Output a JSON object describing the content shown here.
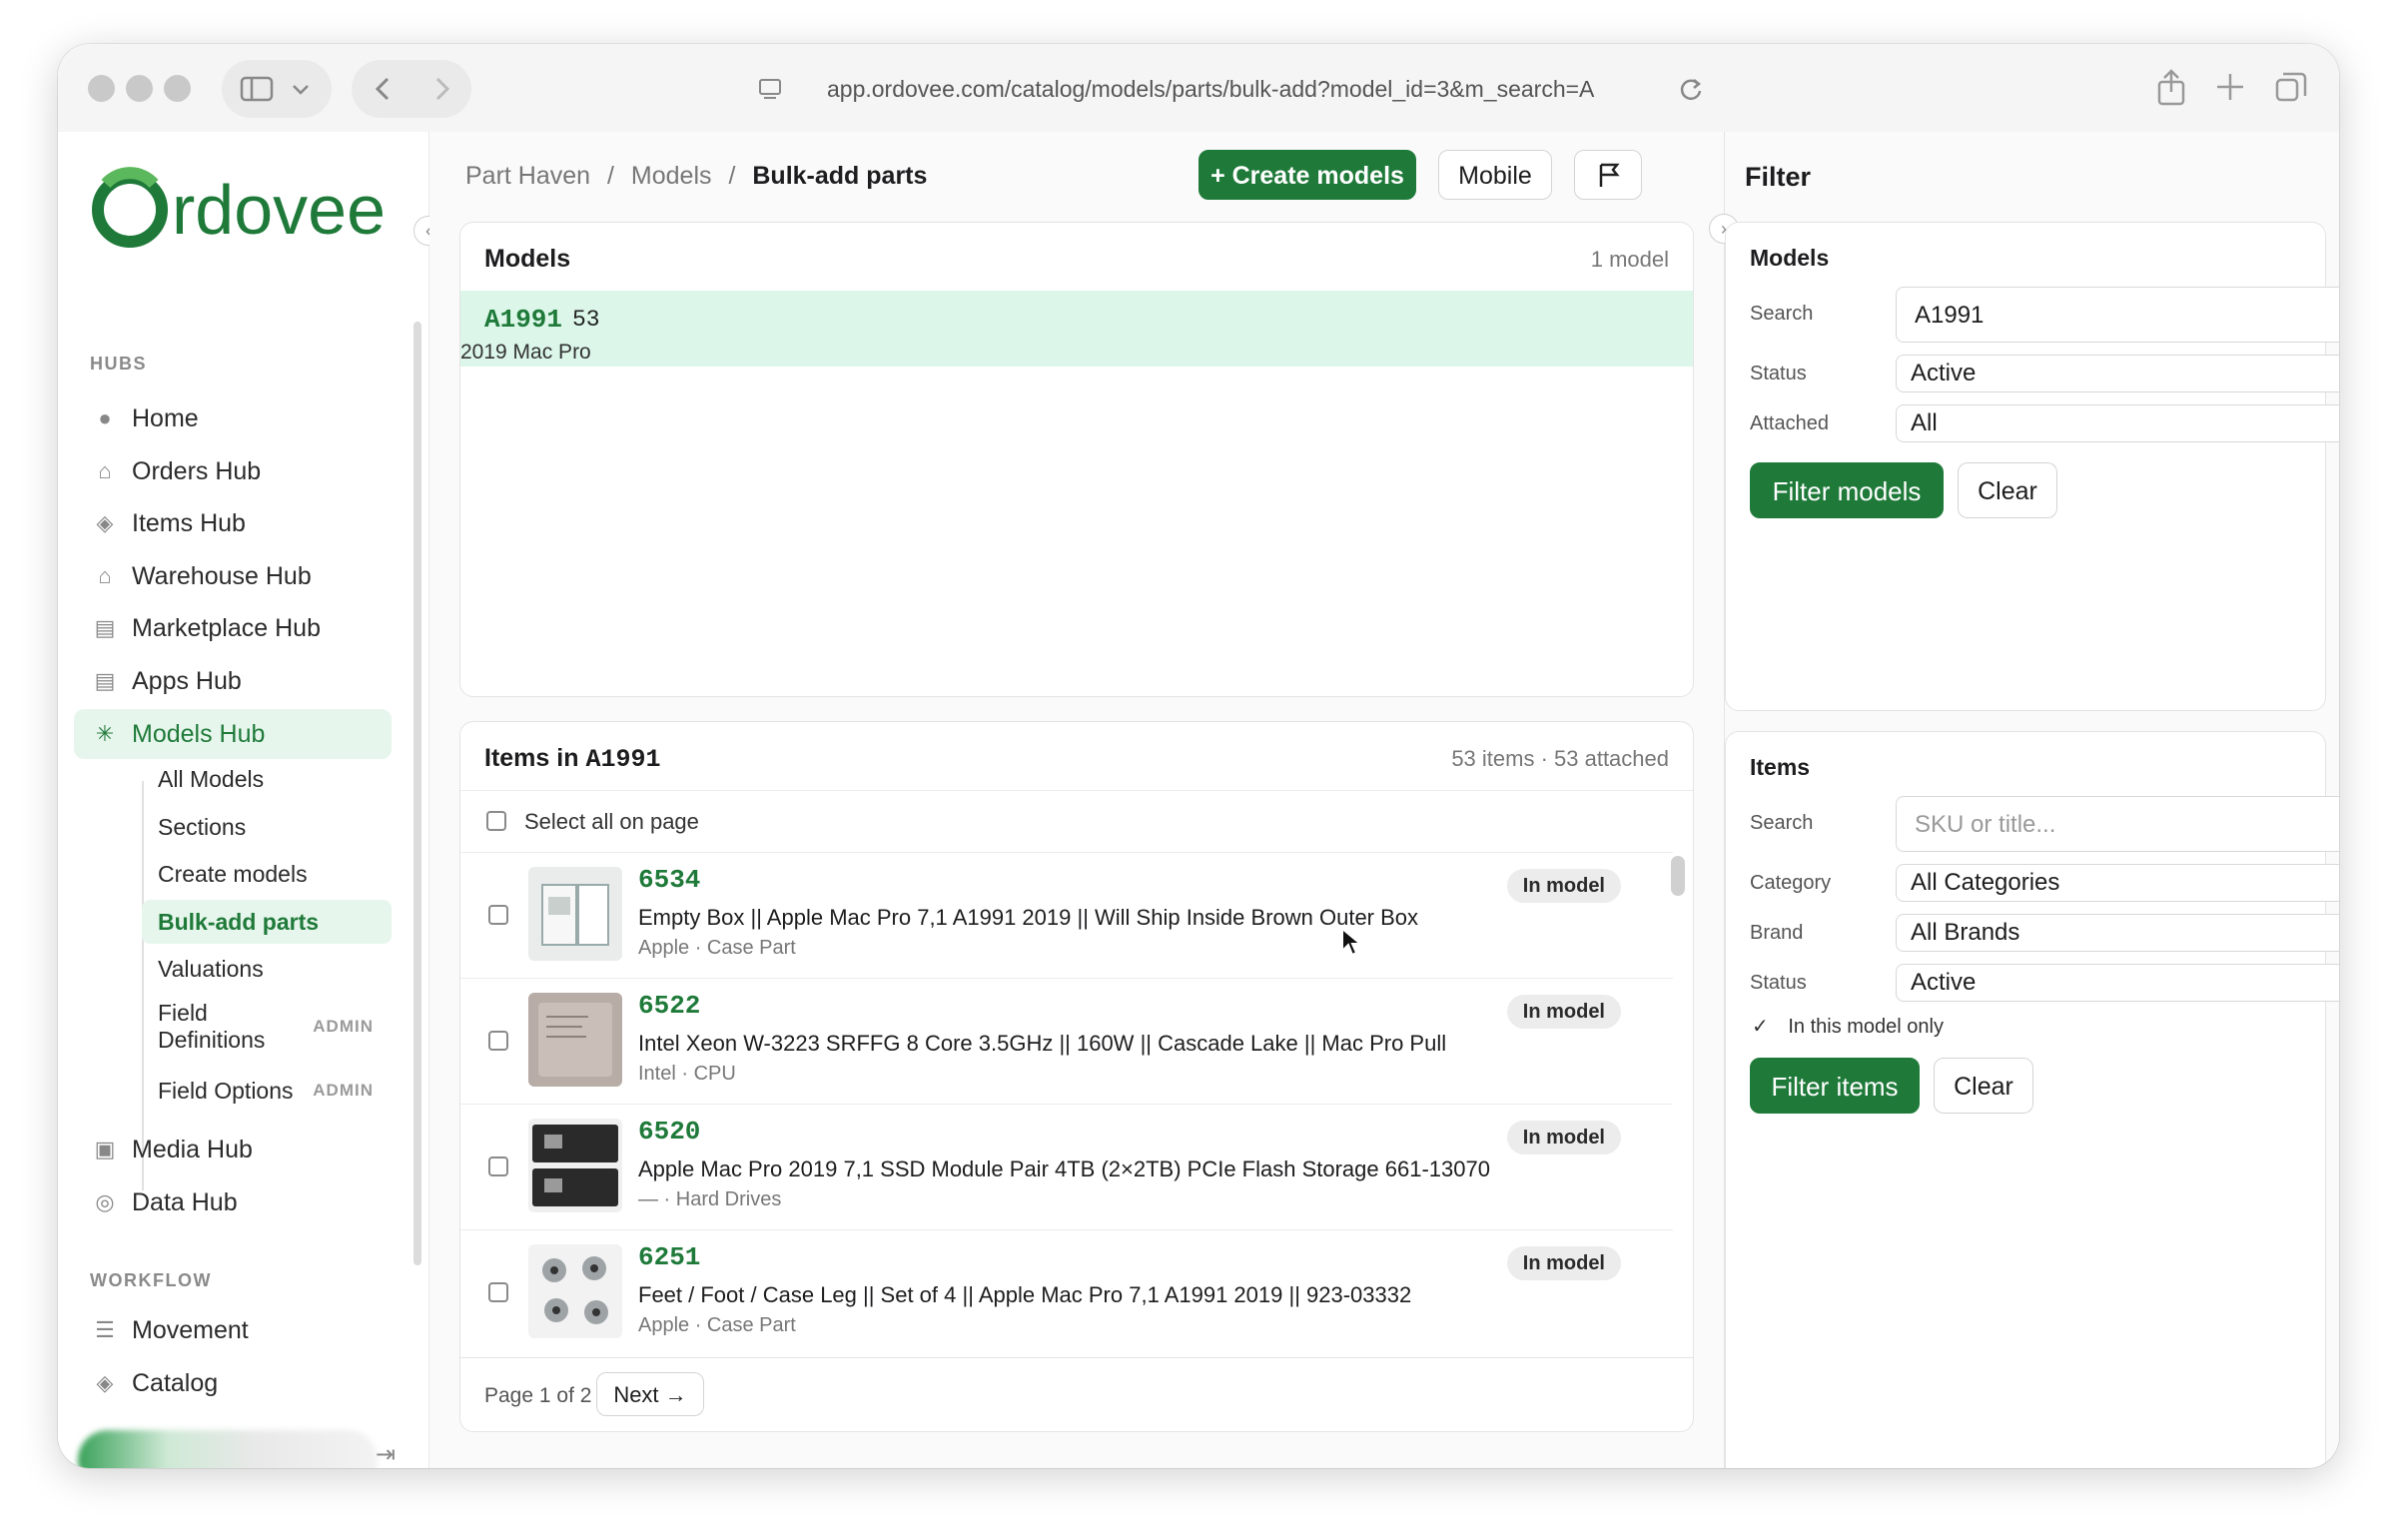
{
  "browser": {
    "url": "app.ordovee.com/catalog/models/parts/bulk-add?model_id=3&m_search=A"
  },
  "sidebar": {
    "logo_text": "Ordovee",
    "sections": {
      "hubs": "HUBS",
      "workflow": "WORKFLOW"
    },
    "hubs": [
      {
        "label": "Home",
        "icon": "dot-icon"
      },
      {
        "label": "Orders Hub",
        "icon": "bag-icon"
      },
      {
        "label": "Items Hub",
        "icon": "cube-icon"
      },
      {
        "label": "Warehouse Hub",
        "icon": "warehouse-icon"
      },
      {
        "label": "Marketplace Hub",
        "icon": "archive-icon"
      },
      {
        "label": "Apps Hub",
        "icon": "archive-icon"
      },
      {
        "label": "Models Hub",
        "icon": "gear-icon",
        "active": true
      }
    ],
    "models_sub": [
      {
        "label": "All Models"
      },
      {
        "label": "Sections"
      },
      {
        "label": "Create models"
      },
      {
        "label": "Bulk-add parts",
        "active": true
      },
      {
        "label": "Valuations"
      },
      {
        "label": "Field Definitions",
        "line1": "Field",
        "line2": "Definitions",
        "badge": "ADMIN"
      },
      {
        "label": "Field Options",
        "badge": "ADMIN"
      }
    ],
    "hubs_after": [
      {
        "label": "Media Hub",
        "icon": "image-icon"
      },
      {
        "label": "Data Hub",
        "icon": "database-icon"
      }
    ],
    "workflow": [
      {
        "label": "Movement",
        "icon": "list-icon"
      },
      {
        "label": "Catalog",
        "icon": "cube-icon"
      }
    ]
  },
  "header": {
    "crumb_1": "Part Haven",
    "crumb_2": "Models",
    "crumb_current": "Bulk-add parts",
    "sep": "/",
    "create_button": "+ Create models",
    "mobile_button": "Mobile"
  },
  "models_card": {
    "title": "Models",
    "count": "1 model",
    "selected_model": {
      "code": "A1991",
      "count": "53",
      "name": "2019 Mac Pro"
    }
  },
  "items_card": {
    "title_prefix": "Items in",
    "title_model": "A1991",
    "summary": "53 items · 53 attached",
    "select_all": "Select all on page",
    "items": [
      {
        "sku": "6534",
        "title": "Empty Box || Apple Mac Pro 7,1 A1991 2019 || Will Ship Inside Brown Outer Box",
        "meta": "Apple · Case Part",
        "badge": "In model"
      },
      {
        "sku": "6522",
        "title": "Intel Xeon W-3223 SRFFG 8 Core 3.5GHz || 160W || Cascade Lake || Mac Pro Pull",
        "meta": "Intel · CPU",
        "badge": "In model"
      },
      {
        "sku": "6520",
        "title": "Apple Mac Pro 2019 7,1 SSD Module Pair 4TB (2×2TB) PCIe Flash Storage 661-13070",
        "meta": "— · Hard Drives",
        "badge": "In model"
      },
      {
        "sku": "6251",
        "title": "Feet / Foot / Case Leg || Set of 4 || Apple Mac Pro 7,1 A1991 2019 || 923-03332",
        "meta": "Apple · Case Part",
        "badge": "In model"
      }
    ],
    "page_label": "Page 1 of 2",
    "next_button": "Next →"
  },
  "filter": {
    "title": "Filter",
    "models": {
      "heading": "Models",
      "search_label": "Search",
      "search_value": "A1991",
      "status_label": "Status",
      "status_value": "Active",
      "attached_label": "Attached",
      "attached_value": "All",
      "filter_button": "Filter models",
      "clear_button": "Clear"
    },
    "items": {
      "heading": "Items",
      "search_label": "Search",
      "search_placeholder": "SKU or title...",
      "category_label": "Category",
      "category_value": "All Categories",
      "brand_label": "Brand",
      "brand_value": "All Brands",
      "status_label": "Status",
      "status_value": "Active",
      "in_model_label": "In this model only",
      "in_model_checked": true,
      "filter_button": "Filter items",
      "clear_button": "Clear"
    }
  },
  "colors": {
    "brand_green": "#1f7a3a",
    "highlight": "#dcf7e9",
    "active_bg": "#e7f6ec"
  }
}
